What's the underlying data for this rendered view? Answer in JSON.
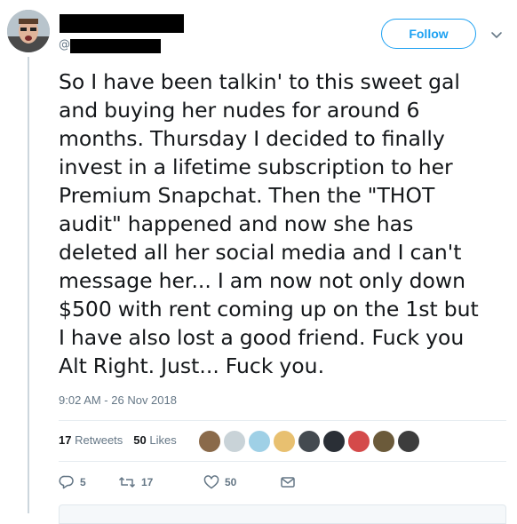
{
  "header": {
    "handle_prefix": "@",
    "follow_label": "Follow"
  },
  "tweet": {
    "text": "So I have been talkin' to this sweet gal\nand buying her nudes for around 6\nmonths. Thursday I decided to finally\ninvest in a lifetime subscription to her\nPremium Snapchat. Then the \"THOT\naudit\" happened and now she has\ndeleted all her social media and I can't\nmessage her... I am now not only down\n$500 with rent coming up on the 1st but\nI have also lost a good friend. Fuck you\nAlt Right. Just... Fuck you.",
    "timestamp": "9:02 AM - 26 Nov 2018"
  },
  "stats": {
    "retweets_count": "17",
    "retweets_label": "Retweets",
    "likes_count": "50",
    "likes_label": "Likes"
  },
  "actions": {
    "reply_count": "5",
    "retweet_count": "17",
    "like_count": "50"
  },
  "colors": {
    "accent": "#1da1f2",
    "text": "#14171a",
    "secondary": "#657786"
  }
}
